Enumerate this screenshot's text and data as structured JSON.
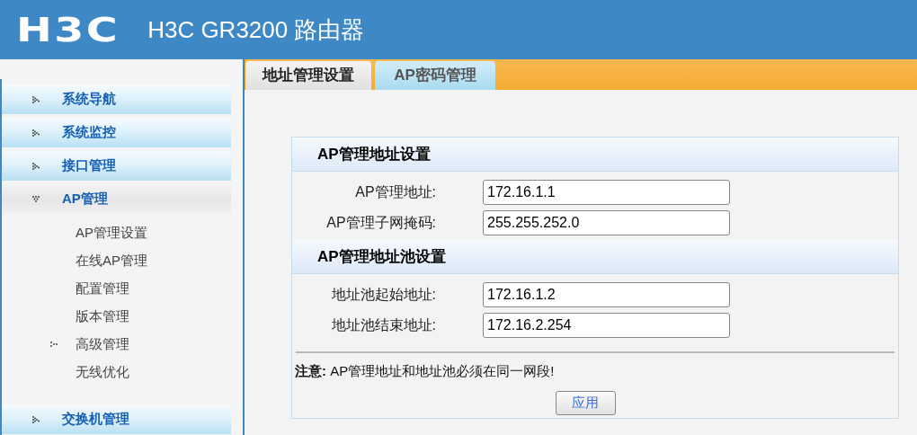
{
  "header": {
    "logo": "H3C",
    "title": "H3C GR3200 路由器"
  },
  "sidebar": {
    "items": [
      {
        "label": "系统导航",
        "expanded": false
      },
      {
        "label": "系统监控",
        "expanded": false
      },
      {
        "label": "接口管理",
        "expanded": false
      },
      {
        "label": "AP管理",
        "expanded": true,
        "children": [
          {
            "label": "AP管理设置",
            "kind": "page"
          },
          {
            "label": "在线AP管理",
            "kind": "page"
          },
          {
            "label": "配置管理",
            "kind": "page"
          },
          {
            "label": "版本管理",
            "kind": "page"
          },
          {
            "label": "高级管理",
            "kind": "group"
          },
          {
            "label": "无线优化",
            "kind": "page"
          }
        ]
      },
      {
        "label": "交换机管理",
        "expanded": false
      }
    ]
  },
  "tabs": [
    {
      "label": "地址管理设置",
      "selected": true
    },
    {
      "label": "AP密码管理",
      "selected": false
    }
  ],
  "sections": [
    {
      "title": "AP管理地址设置",
      "fields": [
        {
          "label": "AP管理地址:",
          "value": "172.16.1.1"
        },
        {
          "label": "AP管理子网掩码:",
          "value": "255.255.252.0"
        }
      ]
    },
    {
      "title": "AP管理地址池设置",
      "fields": [
        {
          "label": "地址池起始地址:",
          "value": "172.16.1.2"
        },
        {
          "label": "地址池结束地址:",
          "value": "172.16.2.254"
        }
      ]
    }
  ],
  "note": "**注意:** AP管理地址和地址池必须在同一网段!",
  "apply_button": "应用"
}
